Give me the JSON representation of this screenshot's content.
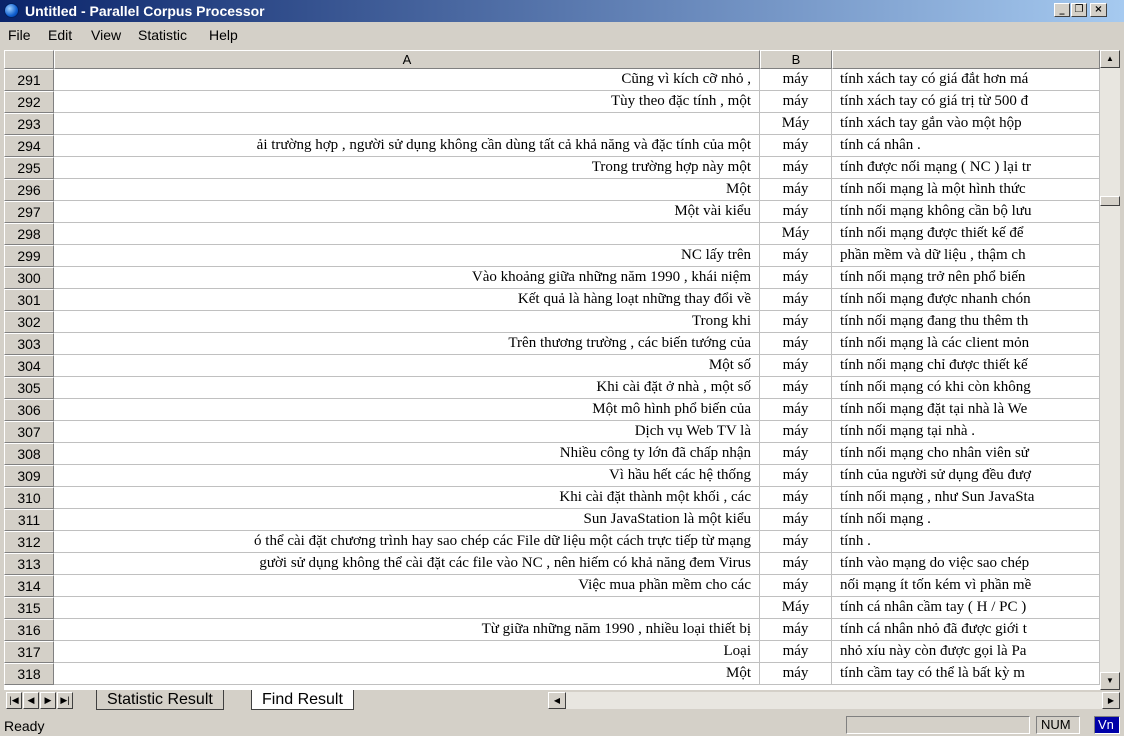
{
  "window": {
    "title": "Untitled - Parallel Corpus Processor"
  },
  "menu": [
    "File",
    "Edit",
    "View",
    "Statistic",
    "Help"
  ],
  "grid": {
    "columns": [
      "A",
      "B",
      ""
    ],
    "rows": [
      {
        "num": "291",
        "a": "Cũng vì kích cỡ nhỏ ,",
        "b": "máy",
        "c": "tính xách tay có giá đắt hơn má"
      },
      {
        "num": "292",
        "a": "Tùy theo đặc tính , một",
        "b": "máy",
        "c": "tính xách tay có giá trị từ 500 đ"
      },
      {
        "num": "293",
        "a": "",
        "b": "Máy",
        "c": "tính xách tay gắn vào một hộp"
      },
      {
        "num": "294",
        "a": "ải trường hợp , người sử dụng không cần dùng tất cả khả năng và đặc tính của một",
        "b": "máy",
        "c": "tính cá nhân ."
      },
      {
        "num": "295",
        "a": "Trong trường hợp này một",
        "b": "máy",
        "c": "tính được nối mạng ( NC ) lại tr"
      },
      {
        "num": "296",
        "a": "Một",
        "b": "máy",
        "c": "tính nối mạng là một hình thức"
      },
      {
        "num": "297",
        "a": "Một vài kiểu",
        "b": "máy",
        "c": "tính nối mạng không cần bộ lưu"
      },
      {
        "num": "298",
        "a": "",
        "b": "Máy",
        "c": "tính nối mạng được thiết kế để"
      },
      {
        "num": "299",
        "a": "NC lấy trên",
        "b": "máy",
        "c": "phần mềm và dữ liệu , thậm ch"
      },
      {
        "num": "300",
        "a": "Vào khoảng giữa những năm 1990 , khái niệm",
        "b": "máy",
        "c": "tính nối mạng trở nên phổ biến"
      },
      {
        "num": "301",
        "a": "Kết quả là hàng loạt những thay đổi về",
        "b": "máy",
        "c": "tính nối mạng được nhanh chón"
      },
      {
        "num": "302",
        "a": "Trong khi",
        "b": "máy",
        "c": "tính nối mạng đang thu thêm th"
      },
      {
        "num": "303",
        "a": "Trên thương trường , các biến tướng của",
        "b": "máy",
        "c": "tính nối mạng là các client mỏn"
      },
      {
        "num": "304",
        "a": "Một số",
        "b": "máy",
        "c": "tính nối mạng chỉ được thiết kế"
      },
      {
        "num": "305",
        "a": "Khi cài đặt ở nhà , một số",
        "b": "máy",
        "c": "tính nối mạng có khi còn không"
      },
      {
        "num": "306",
        "a": "Một mô hình phổ biến của",
        "b": "máy",
        "c": "tính nối mạng đặt tại nhà là We"
      },
      {
        "num": "307",
        "a": "Dịch vụ Web TV là",
        "b": "máy",
        "c": "tính nối mạng tại nhà ."
      },
      {
        "num": "308",
        "a": "Nhiều công ty lớn đã chấp nhận",
        "b": "máy",
        "c": "tính nối mạng cho nhân viên sử"
      },
      {
        "num": "309",
        "a": "Vì hầu hết các hệ thống",
        "b": "máy",
        "c": "tính của người sử dụng đều đượ"
      },
      {
        "num": "310",
        "a": "Khi cài đặt thành một khối , các",
        "b": "máy",
        "c": "tính nối mạng , như Sun JavaSta"
      },
      {
        "num": "311",
        "a": "Sun JavaStation là một kiểu",
        "b": "máy",
        "c": "tính nối mạng ."
      },
      {
        "num": "312",
        "a": "ó thể cài đặt chương trình hay sao chép các File dữ liệu một cách trực tiếp từ mạng",
        "b": "máy",
        "c": "tính ."
      },
      {
        "num": "313",
        "a": "gười sử dụng không thể cài đặt các file vào NC , nên hiếm có khả năng đem Virus",
        "b": "máy",
        "c": "tính vào mạng do việc sao chép"
      },
      {
        "num": "314",
        "a": "Việc mua phần mềm cho các",
        "b": "máy",
        "c": "nối mạng ít tốn kém vì phần mề"
      },
      {
        "num": "315",
        "a": "",
        "b": "Máy",
        "c": "tính cá nhân cầm tay ( H / PC )"
      },
      {
        "num": "316",
        "a": "Từ giữa những năm 1990 , nhiều loại thiết bị",
        "b": "máy",
        "c": "tính cá nhân nhỏ đã được giới t"
      },
      {
        "num": "317",
        "a": "Loại",
        "b": "máy",
        "c": "nhỏ xíu này còn được gọi là Pa"
      },
      {
        "num": "318",
        "a": "Một",
        "b": "máy",
        "c": "tính cầm tay có thể là bất kỳ m"
      }
    ]
  },
  "sheet_tabs": [
    {
      "label": "Statistic Result",
      "active": false
    },
    {
      "label": "Find Result",
      "active": true
    }
  ],
  "status": {
    "text": "Ready",
    "num": "NUM",
    "lang": "Vn"
  }
}
